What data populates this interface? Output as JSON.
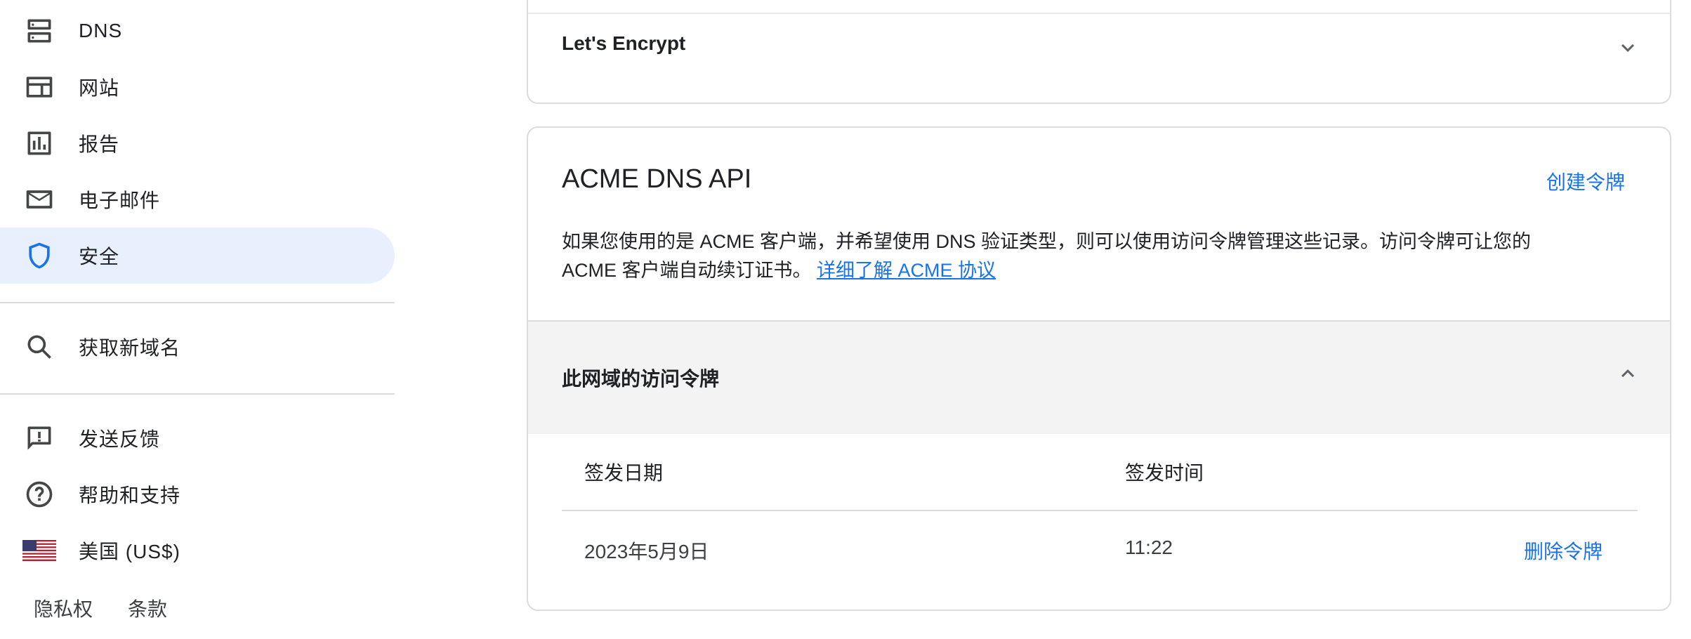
{
  "sidebar": {
    "items": [
      {
        "label": "DNS",
        "icon": "dns-icon"
      },
      {
        "label": "网站",
        "icon": "website-icon"
      },
      {
        "label": "报告",
        "icon": "reports-icon"
      },
      {
        "label": "电子邮件",
        "icon": "email-icon"
      },
      {
        "label": "安全",
        "icon": "shield-icon",
        "active": true
      }
    ],
    "get_domain": {
      "label": "获取新域名",
      "icon": "search-icon"
    },
    "feedback": {
      "label": "发送反馈",
      "icon": "feedback-icon"
    },
    "help": {
      "label": "帮助和支持",
      "icon": "help-icon"
    },
    "region": {
      "label": "美国 (US$)",
      "icon": "us-flag-icon"
    },
    "footer": {
      "privacy": "隐私权",
      "terms": "条款"
    }
  },
  "lets_encrypt": {
    "title": "Let's Encrypt",
    "expanded": false
  },
  "acme": {
    "title": "ACME DNS API",
    "create_token": "创建令牌",
    "description_line1": "如果您使用的是 ACME 客户端，并希望使用 DNS 验证类型，则可以使用访问令牌管理这些记录。访问令牌可让您的",
    "description_line2": "ACME 客户端自动续订证书。",
    "learn_more": "详细了解 ACME 协议",
    "tokens_section": {
      "title": "此网域的访问令牌",
      "expanded": true,
      "columns": [
        "签发日期",
        "签发时间"
      ],
      "rows": [
        {
          "date": "2023年5月9日",
          "time": "11:22",
          "action": "删除令牌"
        }
      ]
    }
  },
  "colors": {
    "accent": "#1a73e8",
    "active_bg": "#e8f0fe",
    "section_bg": "#f3f3f3"
  }
}
